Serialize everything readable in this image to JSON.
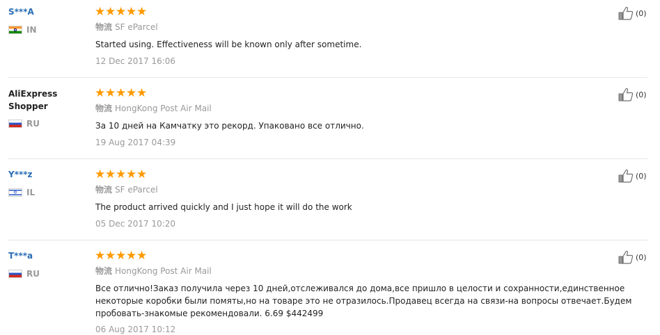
{
  "reviews": [
    {
      "user": "S***A",
      "country": "IN",
      "rating": 5,
      "shipping_label": "物流",
      "shipping_method": "SF eParcel",
      "text": "Started using. Effectiveness will be known only after sometime.",
      "date": "12 Dec 2017 16:06",
      "helpful_count": "(0)"
    },
    {
      "user": "AliExpress Shopper",
      "country": "RU",
      "rating": 5,
      "shipping_label": "物流",
      "shipping_method": "HongKong Post Air Mail",
      "text": "За 10 дней на Камчатку это рекорд. Упаковано все отлично.",
      "date": "19 Aug 2017 04:39",
      "helpful_count": "(0)"
    },
    {
      "user": "Y***z",
      "country": "IL",
      "rating": 5,
      "shipping_label": "物流",
      "shipping_method": "SF eParcel",
      "text": "The product arrived quickly and I just hope it will do the work",
      "date": "05 Dec 2017 10:20",
      "helpful_count": "(0)"
    },
    {
      "user": "T***a",
      "country": "RU",
      "rating": 5,
      "shipping_label": "物流",
      "shipping_method": "HongKong Post Air Mail",
      "text": "Все отлично!Заказ получила через 10 дней,отслеживался до дома,все пришло в целости и сохранности,единственное некоторые коробки были помяты,но на товаре это не отразилось.Продавец всегда на связи-на вопросы отвечает.Будем пробовать-знакомые рекомендовали. 6.69 $442499",
      "date": "06 Aug 2017 10:12",
      "helpful_count": "(0)"
    }
  ],
  "icons": {
    "star": "star-icon",
    "thumbs_up": "thumbs-up-icon",
    "flag": "country-flag-icon"
  },
  "colors": {
    "star": "#ff9a00",
    "masked_user": "#2a6eb5",
    "muted": "#999999",
    "text": "#222222",
    "divider": "#e6e6e6"
  }
}
